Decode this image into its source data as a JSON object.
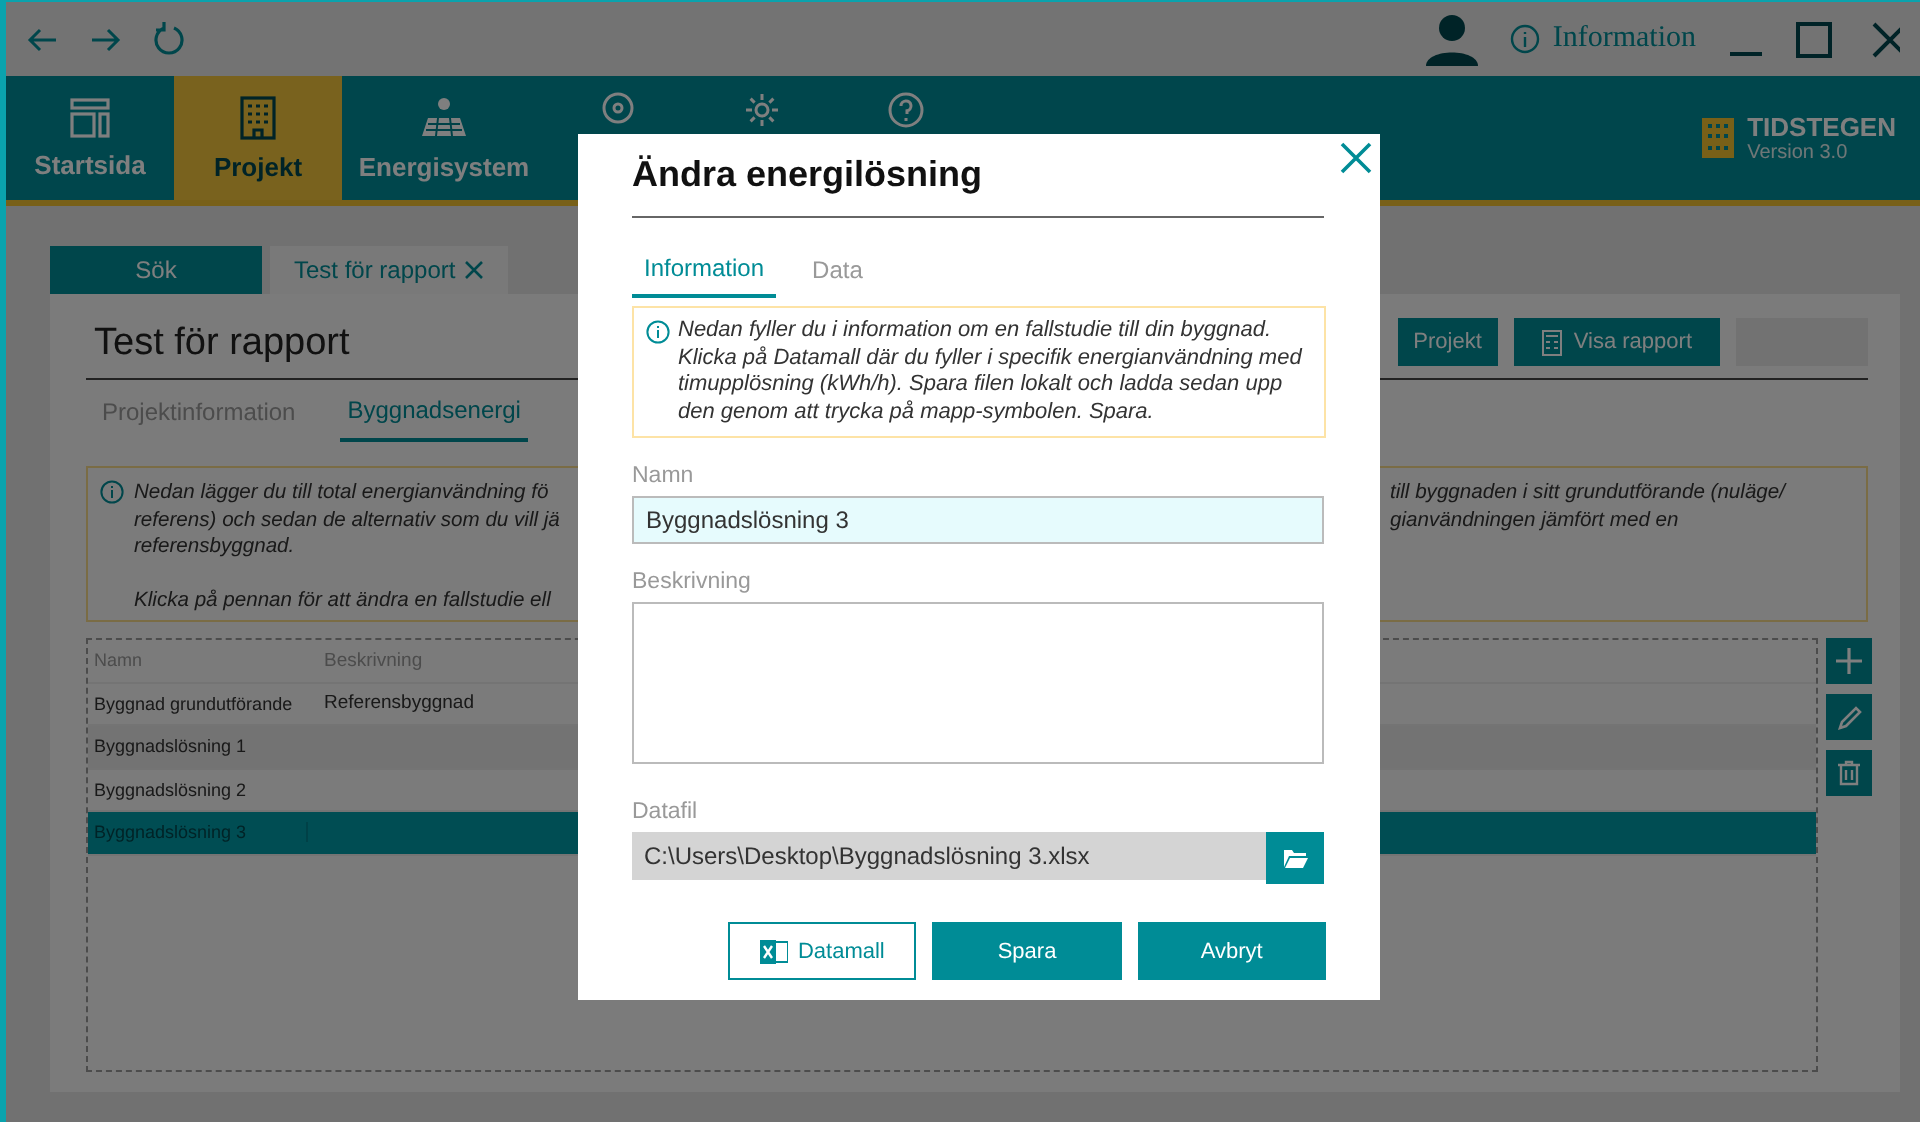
{
  "window": {
    "info_label": "Information"
  },
  "nav": {
    "items": [
      {
        "label": "Startsida",
        "selected": false
      },
      {
        "label": "Projekt",
        "selected": true
      },
      {
        "label": "Energisystem",
        "selected": false
      }
    ]
  },
  "app": {
    "name": "TIDSTEGEN",
    "version": "Version 3.0"
  },
  "doc_tabs": [
    {
      "label": "Sök",
      "selected": false,
      "closable": false
    },
    {
      "label": "Test för rapport",
      "selected": true,
      "closable": true
    }
  ],
  "page": {
    "title": "Test för rapport",
    "actions": [
      {
        "label": "Projekt",
        "disabled": false,
        "kind": "plain"
      },
      {
        "label": "Visa rapport",
        "disabled": false,
        "kind": "report"
      },
      {
        "disabled": true,
        "kind": "blank"
      }
    ],
    "subtabs": [
      {
        "label": "Projektinformation",
        "selected": false
      },
      {
        "label": "Byggnadsenergi",
        "selected": true
      }
    ],
    "info": {
      "left_lines": [
        "Nedan lägger du till total energianvändning fö",
        "referens) och sedan de alternativ som du vill jä",
        "referensbyggnad.",
        "Klicka på pennan för att ändra en fallstudie ell"
      ],
      "right_lines": [
        "till byggnaden i sitt grundutförande (nuläge/",
        "gianvändningen jämfört med en"
      ]
    },
    "table": {
      "columns": [
        "Namn",
        "Beskrivning"
      ],
      "rows": [
        {
          "cells": [
            "Byggnad grundutförande",
            "Referensbyggnad"
          ],
          "selected": false
        },
        {
          "cells": [
            "Byggnadslösning 1"
          ],
          "selected": false
        },
        {
          "cells": [
            "Byggnadslösning 2"
          ],
          "selected": false
        },
        {
          "cells": [
            "Byggnadslösning 3"
          ],
          "selected": true
        }
      ]
    }
  },
  "dialog": {
    "title": "Ändra energilösning",
    "tabs": [
      {
        "label": "Information",
        "selected": true
      },
      {
        "label": "Data",
        "selected": false
      }
    ],
    "info": "Nedan fyller du i information om en fallstudie till din byggnad. Klicka på Datamall där du fyller i specifik energianvändning med timupplösning (kWh/h). Spara filen lokalt och ladda sedan upp den genom att trycka på mapp-symbolen. Spara.",
    "fields": [
      {
        "kind": "text",
        "label": "Namn",
        "value": "Byggnadslösning 3",
        "focused": true
      },
      {
        "kind": "textarea",
        "label": "Beskrivning",
        "focused": false
      },
      {
        "kind": "file",
        "label": "Datafil",
        "value": "C:\\Users\\Desktop\\Byggnadslösning 3.xlsx",
        "disabled": true
      }
    ],
    "buttons": [
      {
        "label": "Datamall",
        "kind": "outline"
      },
      {
        "label": "Spara",
        "kind": "primary"
      },
      {
        "label": "Avbryt",
        "kind": "primary"
      }
    ]
  }
}
